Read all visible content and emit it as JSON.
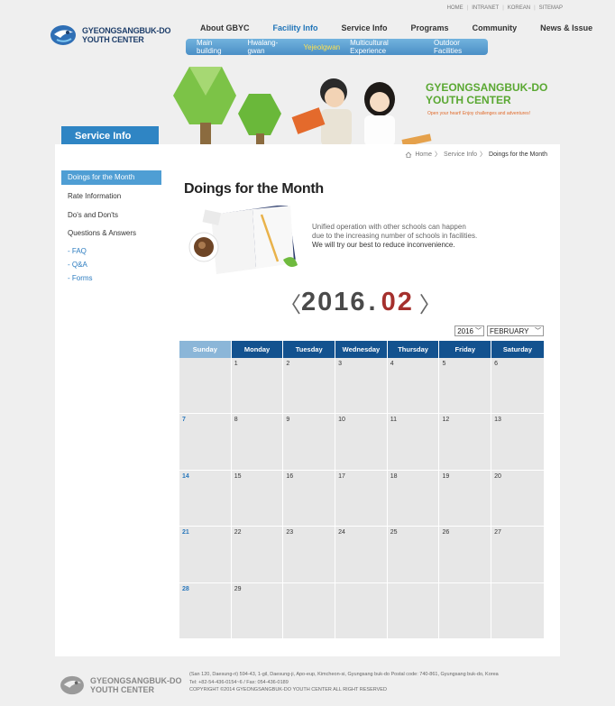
{
  "util_links": [
    "HOME",
    "INTRANET",
    "KOREAN",
    "SITEMAP"
  ],
  "logo": {
    "line1": "GYEONGSANGBUK-DO",
    "line2": "YOUTH CENTER"
  },
  "gnb": [
    {
      "label": "About GBYC"
    },
    {
      "label": "Facility Info"
    },
    {
      "label": "Service Info"
    },
    {
      "label": "Programs"
    },
    {
      "label": "Community"
    },
    {
      "label": "News & Issue"
    }
  ],
  "subnav": [
    "Main building",
    "Hwalang-gwan",
    "Yejeolgwan",
    "Multicultural Experience",
    "Outdoor Facilities"
  ],
  "banner": {
    "title1": "GYEONGSANGBUK-DO",
    "title2": "YOUTH CENTER",
    "slogan": "Open your heart! Enjoy challenges and adventures!"
  },
  "service_tab": "Service Info",
  "lnb": {
    "items": [
      "Doings for the Month",
      "Rate Information",
      "Do's and Don'ts",
      "Questions & Answers"
    ],
    "subs": [
      "- FAQ",
      "- Q&A",
      "- Forms"
    ]
  },
  "breadcrumb": {
    "home": "Home",
    "sep": "〉",
    "section": "Service Info",
    "current": "Doings for the Month"
  },
  "page_title": "Doings for the Month",
  "intro": {
    "line1": "Unified operation with other schools can happen",
    "line2": "due to the increasing number of schools in facilities.",
    "line3": "We will try our best to reduce inconvenience."
  },
  "month_nav": {
    "prev": "〈",
    "year": "2016",
    "dot": ".",
    "month": "02",
    "next": "〉"
  },
  "selects": {
    "year": "2016",
    "month": "FEBRUARY"
  },
  "weekdays": [
    "Sunday",
    "Monday",
    "Tuesday",
    "Wednesday",
    "Thursday",
    "Friday",
    "Saturday"
  ],
  "weeks": [
    [
      "",
      "1",
      "2",
      "3",
      "4",
      "5",
      "6"
    ],
    [
      "7",
      "8",
      "9",
      "10",
      "11",
      "12",
      "13"
    ],
    [
      "14",
      "15",
      "16",
      "17",
      "18",
      "19",
      "20"
    ],
    [
      "21",
      "22",
      "23",
      "24",
      "25",
      "26",
      "27"
    ],
    [
      "28",
      "29",
      "",
      "",
      "",
      "",
      ""
    ]
  ],
  "footer": {
    "logo1": "GYEONGSANGBUK-DO",
    "logo2": "YOUTH CENTER",
    "address": "(San 120, Daesung-ri) 594-43, 1-gil, Daesung-ji, Apo-eup, Kimcheon-si, Gyungsang buk-do Postal code: 740-861, Gyungsang buk-do, Korea",
    "tel": "Tel: +82-54-436-0154~6 / Fax: 054-436-0189",
    "copyright": "COPYRIGHT ©2014  GYEONGSANGBUK-DO YOUTH CENTER  ALL RIGHT RESERVED"
  },
  "colors": {
    "nav_blue": "#13528f",
    "accent": "#2f85c4",
    "active_sub": "#ffe24f",
    "month_red": "#a5302d",
    "green": "#5aa832"
  }
}
